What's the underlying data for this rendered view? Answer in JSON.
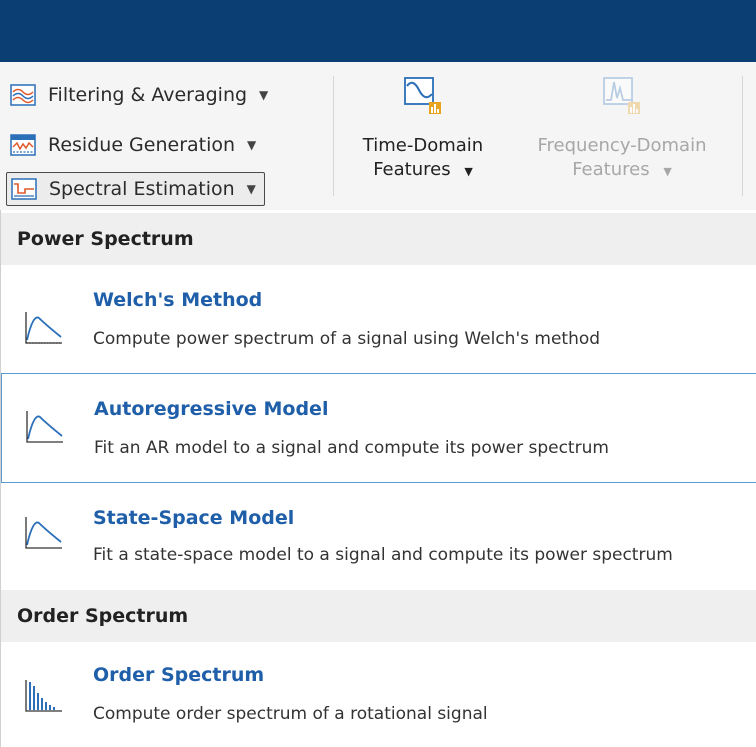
{
  "ribbon": {
    "menus": [
      {
        "label": "Filtering & Averaging",
        "icon": "filtering-averaging-icon"
      },
      {
        "label": "Residue Generation",
        "icon": "residue-generation-icon"
      },
      {
        "label": "Spectral Estimation",
        "icon": "spectral-estimation-icon"
      }
    ],
    "features": [
      {
        "line1": "Time-Domain",
        "line2": "Features",
        "icon": "time-domain-features-icon",
        "enabled": true
      },
      {
        "line1": "Frequency-Domain",
        "line2": "Features",
        "icon": "frequency-domain-features-icon",
        "enabled": false
      }
    ],
    "caret": "▼"
  },
  "dropdown": {
    "sections": [
      {
        "header": "Power Spectrum",
        "items": [
          {
            "title": "Welch's Method",
            "description": "Compute power spectrum of a signal using Welch's method",
            "icon": "power-spectrum-icon"
          },
          {
            "title": "Autoregressive Model",
            "description": "Fit an AR model to a signal and compute its power spectrum",
            "icon": "power-spectrum-icon"
          },
          {
            "title": "State-Space Model",
            "description": "Fit a state-space model to a signal and compute its power spectrum",
            "icon": "power-spectrum-icon"
          }
        ]
      },
      {
        "header": "Order Spectrum",
        "items": [
          {
            "title": "Order Spectrum",
            "description": "Compute order spectrum of a rotational signal",
            "icon": "order-spectrum-icon"
          }
        ]
      }
    ]
  },
  "colors": {
    "titlebar": "#0b3f73",
    "item_title": "#1f5ea8",
    "hover_border": "#5b9bd5",
    "ribbon_bg": "#f5f5f5"
  }
}
